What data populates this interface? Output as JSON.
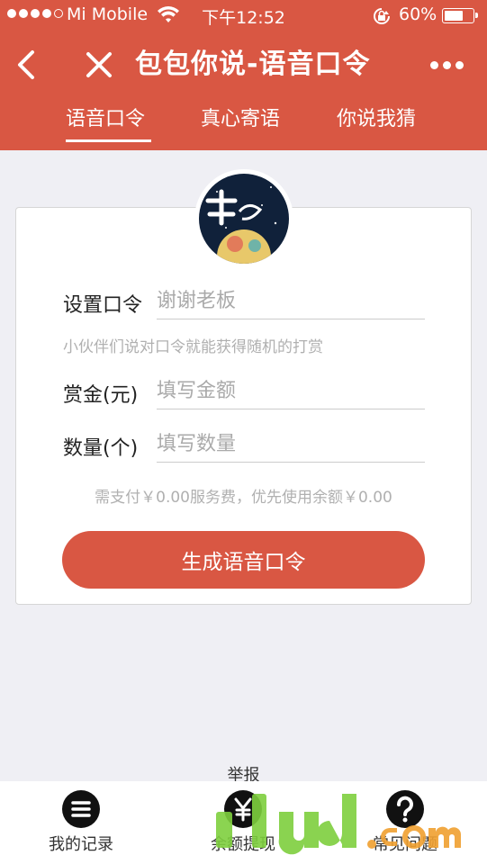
{
  "status_bar": {
    "carrier": "Mi Mobile",
    "time": "下午12:52",
    "battery_percent": "60%",
    "battery_level": 0.6,
    "signal_bars": 4
  },
  "nav": {
    "title": "包包你说-语音口令",
    "back_icon": "chevron-left-icon",
    "close_icon": "close-icon",
    "more_icon": "more-dots-icon"
  },
  "tabs": [
    {
      "label": "语音口令",
      "active": true
    },
    {
      "label": "真心寄语",
      "active": false
    },
    {
      "label": "你说我猜",
      "active": false
    }
  ],
  "form": {
    "password": {
      "label": "设置口令",
      "placeholder": "谢谢老板"
    },
    "hint": "小伙伴们说对口令就能获得随机的打赏",
    "amount": {
      "label": "赏金(元)",
      "placeholder": "填写金额"
    },
    "quantity": {
      "label": "数量(个)",
      "placeholder": "填写数量"
    },
    "fee_note": "需支付￥0.00服务费，优先使用余额￥0.00",
    "submit_label": "生成语音口令"
  },
  "report_label": "举报",
  "bottom_nav": [
    {
      "label": "我的记录",
      "icon": "list-icon"
    },
    {
      "label": "余额提现",
      "icon": "yen-icon"
    },
    {
      "label": "常见问题",
      "icon": "question-icon"
    }
  ],
  "colors": {
    "brand": "#d95743",
    "background": "#efeff4"
  }
}
